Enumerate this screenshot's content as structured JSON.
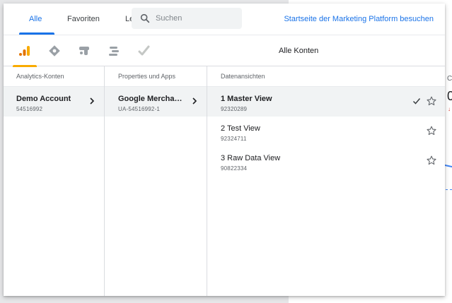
{
  "tabs": [
    {
      "label": "Alle"
    },
    {
      "label": "Favoriten"
    },
    {
      "label": "Le"
    }
  ],
  "search": {
    "placeholder": "Suchen"
  },
  "marketing_platform_link": "Startseite der Marketing Platform besuchen",
  "products": [
    {
      "icon": "analytics-icon"
    },
    {
      "icon": "tag-manager-icon"
    },
    {
      "icon": "optimize-icon"
    },
    {
      "icon": "data-studio-icon"
    },
    {
      "icon": "surveys-icon"
    }
  ],
  "scope_label": "Alle Konten",
  "columns": {
    "accounts": {
      "header": "Analytics-Konten",
      "items": [
        {
          "name": "Demo Account",
          "id": "54516992",
          "selected": true
        }
      ]
    },
    "properties": {
      "header": "Properties und Apps",
      "items": [
        {
          "name": "Google Merchand…",
          "id": "UA-54516992-1",
          "selected": true
        }
      ]
    },
    "views": {
      "header": "Datenansichten",
      "items": [
        {
          "name": "1 Master View",
          "id": "92320289",
          "selected": true
        },
        {
          "name": "2 Test View",
          "id": "92324711",
          "selected": false
        },
        {
          "name": "3 Raw Data View",
          "id": "90822334",
          "selected": false
        }
      ]
    }
  },
  "background": {
    "fragment_letter": "C",
    "fragment_number": "0",
    "fragment_arrow": "↓"
  },
  "colors": {
    "accent": "#1a73e8",
    "analytics_orange": "#f9ab00",
    "selected_row": "#f1f3f4"
  }
}
